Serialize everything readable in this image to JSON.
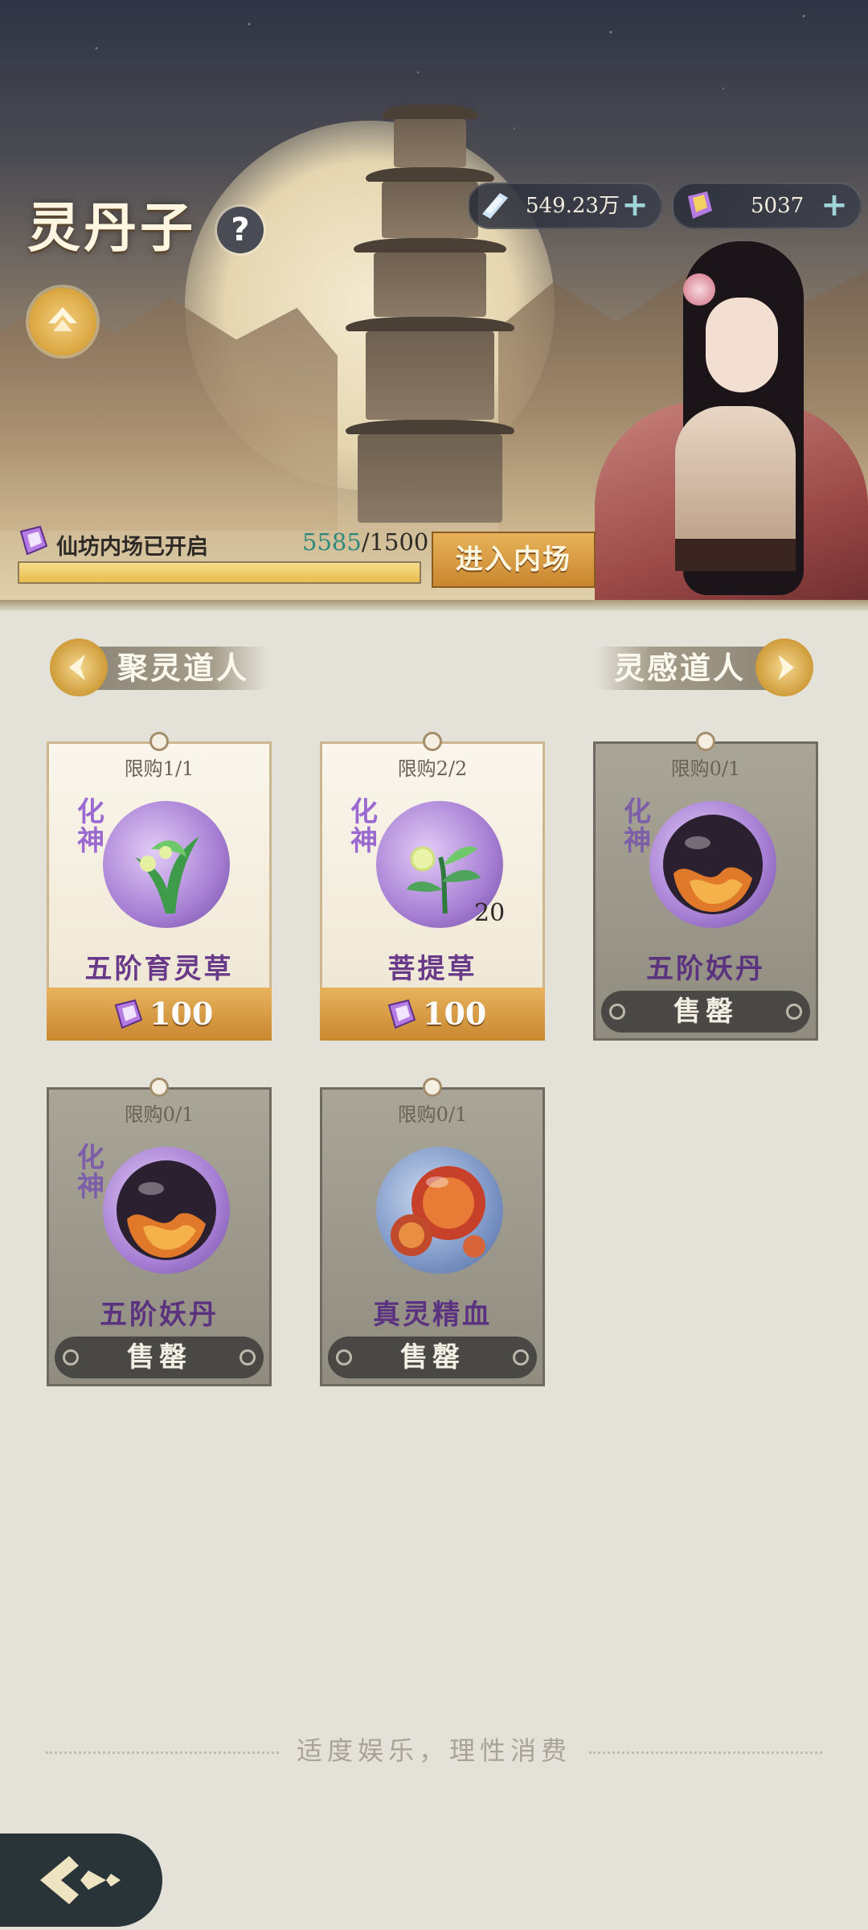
{
  "header": {
    "title": "灵丹子",
    "help_label": "?"
  },
  "currencies": [
    {
      "icon": "crystal-icon",
      "value": "549.23万",
      "plus": "+"
    },
    {
      "icon": "talisman-icon",
      "value": "5037",
      "plus": "+"
    }
  ],
  "status": {
    "text": "仙坊内场已开启",
    "progress_current": "5585",
    "progress_total": "/1500",
    "progress_fraction": 1.0,
    "enter_label": "进入内场"
  },
  "nav": {
    "prev_label": "聚灵道人",
    "next_label": "灵感道人"
  },
  "cards": [
    {
      "limit": "限购1/1",
      "tier": "化神",
      "name": "五阶育灵草",
      "price": "100",
      "state": "buy",
      "qty": ""
    },
    {
      "limit": "限购2/2",
      "tier": "化神",
      "name": "菩提草",
      "price": "100",
      "state": "buy",
      "qty": "20"
    },
    {
      "limit": "限购0/1",
      "tier": "化神",
      "name": "五阶妖丹",
      "sold_label": "售罄",
      "state": "sold",
      "qty": ""
    },
    {
      "limit": "限购0/1",
      "tier": "化神",
      "name": "五阶妖丹",
      "sold_label": "售罄",
      "state": "sold",
      "qty": ""
    },
    {
      "limit": "限购0/1",
      "tier": "",
      "name": "真灵精血",
      "sold_label": "售罄",
      "state": "sold",
      "qty": ""
    }
  ],
  "footer": {
    "note": "适度娱乐，理性消费"
  },
  "colors": {
    "accent_gold": "#d9a43e",
    "tier_purple": "#9a6ad0",
    "progress_teal": "#2f8a7c"
  }
}
